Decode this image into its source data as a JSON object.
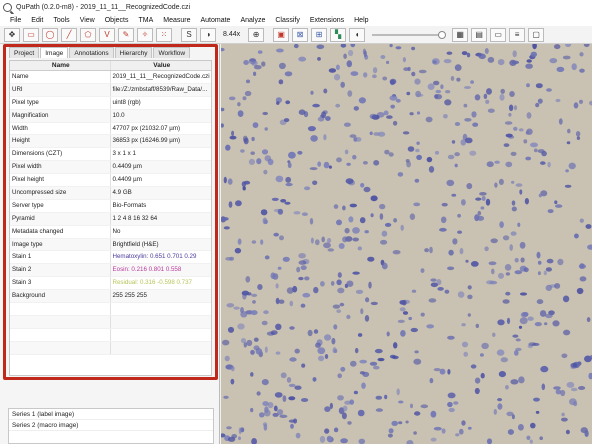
{
  "window": {
    "title": "QuPath (0.2.0-m8) - 2019_11_11__RecognizedCode.czi"
  },
  "menu": [
    "File",
    "Edit",
    "Tools",
    "View",
    "Objects",
    "TMA",
    "Measure",
    "Automate",
    "Analyze",
    "Classify",
    "Extensions",
    "Help"
  ],
  "toolbar": {
    "zoom": "8.44x",
    "buttons": [
      "move-tool",
      "rectangle-tool",
      "ellipse-tool",
      "line-tool",
      "polygon-tool",
      "polyline-tool",
      "brush-tool",
      "wand-tool",
      "points-tool",
      "selection-mode",
      "brightness-contrast",
      "zoom-to-fit",
      "show-annotations",
      "fill-annotations",
      "show-tma",
      "show-detections",
      "opacity",
      "show-grid",
      "show-pixel-classification",
      "measurement-table",
      "show-overview",
      "show-log"
    ]
  },
  "tabs": [
    {
      "label": "Project",
      "active": false
    },
    {
      "label": "Image",
      "active": true
    },
    {
      "label": "Annotations",
      "active": false
    },
    {
      "label": "Hierarchy",
      "active": false
    },
    {
      "label": "Workflow",
      "active": false
    }
  ],
  "table": {
    "headers": {
      "name": "Name",
      "value": "Value"
    },
    "rows": [
      {
        "name": "Name",
        "value": "2019_11_11__RecognizedCode.czi"
      },
      {
        "name": "URI",
        "value": "file:/Z:/zmbstaff/8539/Raw_Data/..."
      },
      {
        "name": "Pixel type",
        "value": "uint8 (rgb)"
      },
      {
        "name": "Magnification",
        "value": "10.0"
      },
      {
        "name": "Width",
        "value": "47707 px (21032.07 µm)"
      },
      {
        "name": "Height",
        "value": "36853 px (16246.99 µm)"
      },
      {
        "name": "Dimensions (CZT)",
        "value": "3 x 1 x 1"
      },
      {
        "name": "Pixel width",
        "value": "0.4409 µm"
      },
      {
        "name": "Pixel height",
        "value": "0.4409 µm"
      },
      {
        "name": "Uncompressed size",
        "value": "4.9 GB"
      },
      {
        "name": "Server type",
        "value": "Bio-Formats"
      },
      {
        "name": "Pyramid",
        "value": "1 2 4 8 16 32 64"
      },
      {
        "name": "Metadata changed",
        "value": "No"
      },
      {
        "name": "Image type",
        "value": "Brightfield (H&E)"
      },
      {
        "name": "Stain 1",
        "value": "Hematoxylin: 0.651 0.701 0.29"
      },
      {
        "name": "Stain 2",
        "value": "Eosin: 0.216 0.801 0.558"
      },
      {
        "name": "Stain 3",
        "value": "Residual: 0.316 -0.598 0.737"
      },
      {
        "name": "Background",
        "value": "255 255 255"
      }
    ]
  },
  "associated_images": [
    "Series 1 (label image)",
    "Series 2 (macro image)"
  ],
  "colors": {
    "highlight": "#c0281c",
    "stain1": "#4a3a9c",
    "stain2": "#b83a9a",
    "stain3": "#b9c45a",
    "tissue_bg": "#c9c2b2",
    "nuclei": "#5a5fb0"
  }
}
